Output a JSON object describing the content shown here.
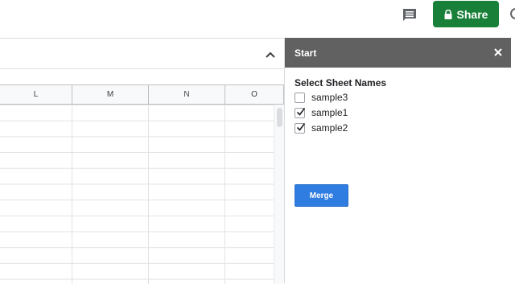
{
  "toolbar": {
    "comment_icon": "comment-icon",
    "share_label": "Share",
    "share_icon": "lock-icon",
    "share_color": "#188038"
  },
  "sheet": {
    "columns": [
      "L",
      "M",
      "N",
      "O"
    ]
  },
  "sidebar": {
    "title": "Start",
    "header_color": "#616161",
    "section_title": "Select Sheet Names",
    "sheets": [
      {
        "name": "sample3",
        "checked": false
      },
      {
        "name": "sample1",
        "checked": true
      },
      {
        "name": "sample2",
        "checked": true
      }
    ],
    "merge_label": "Merge",
    "merge_color": "#2f7de1"
  }
}
